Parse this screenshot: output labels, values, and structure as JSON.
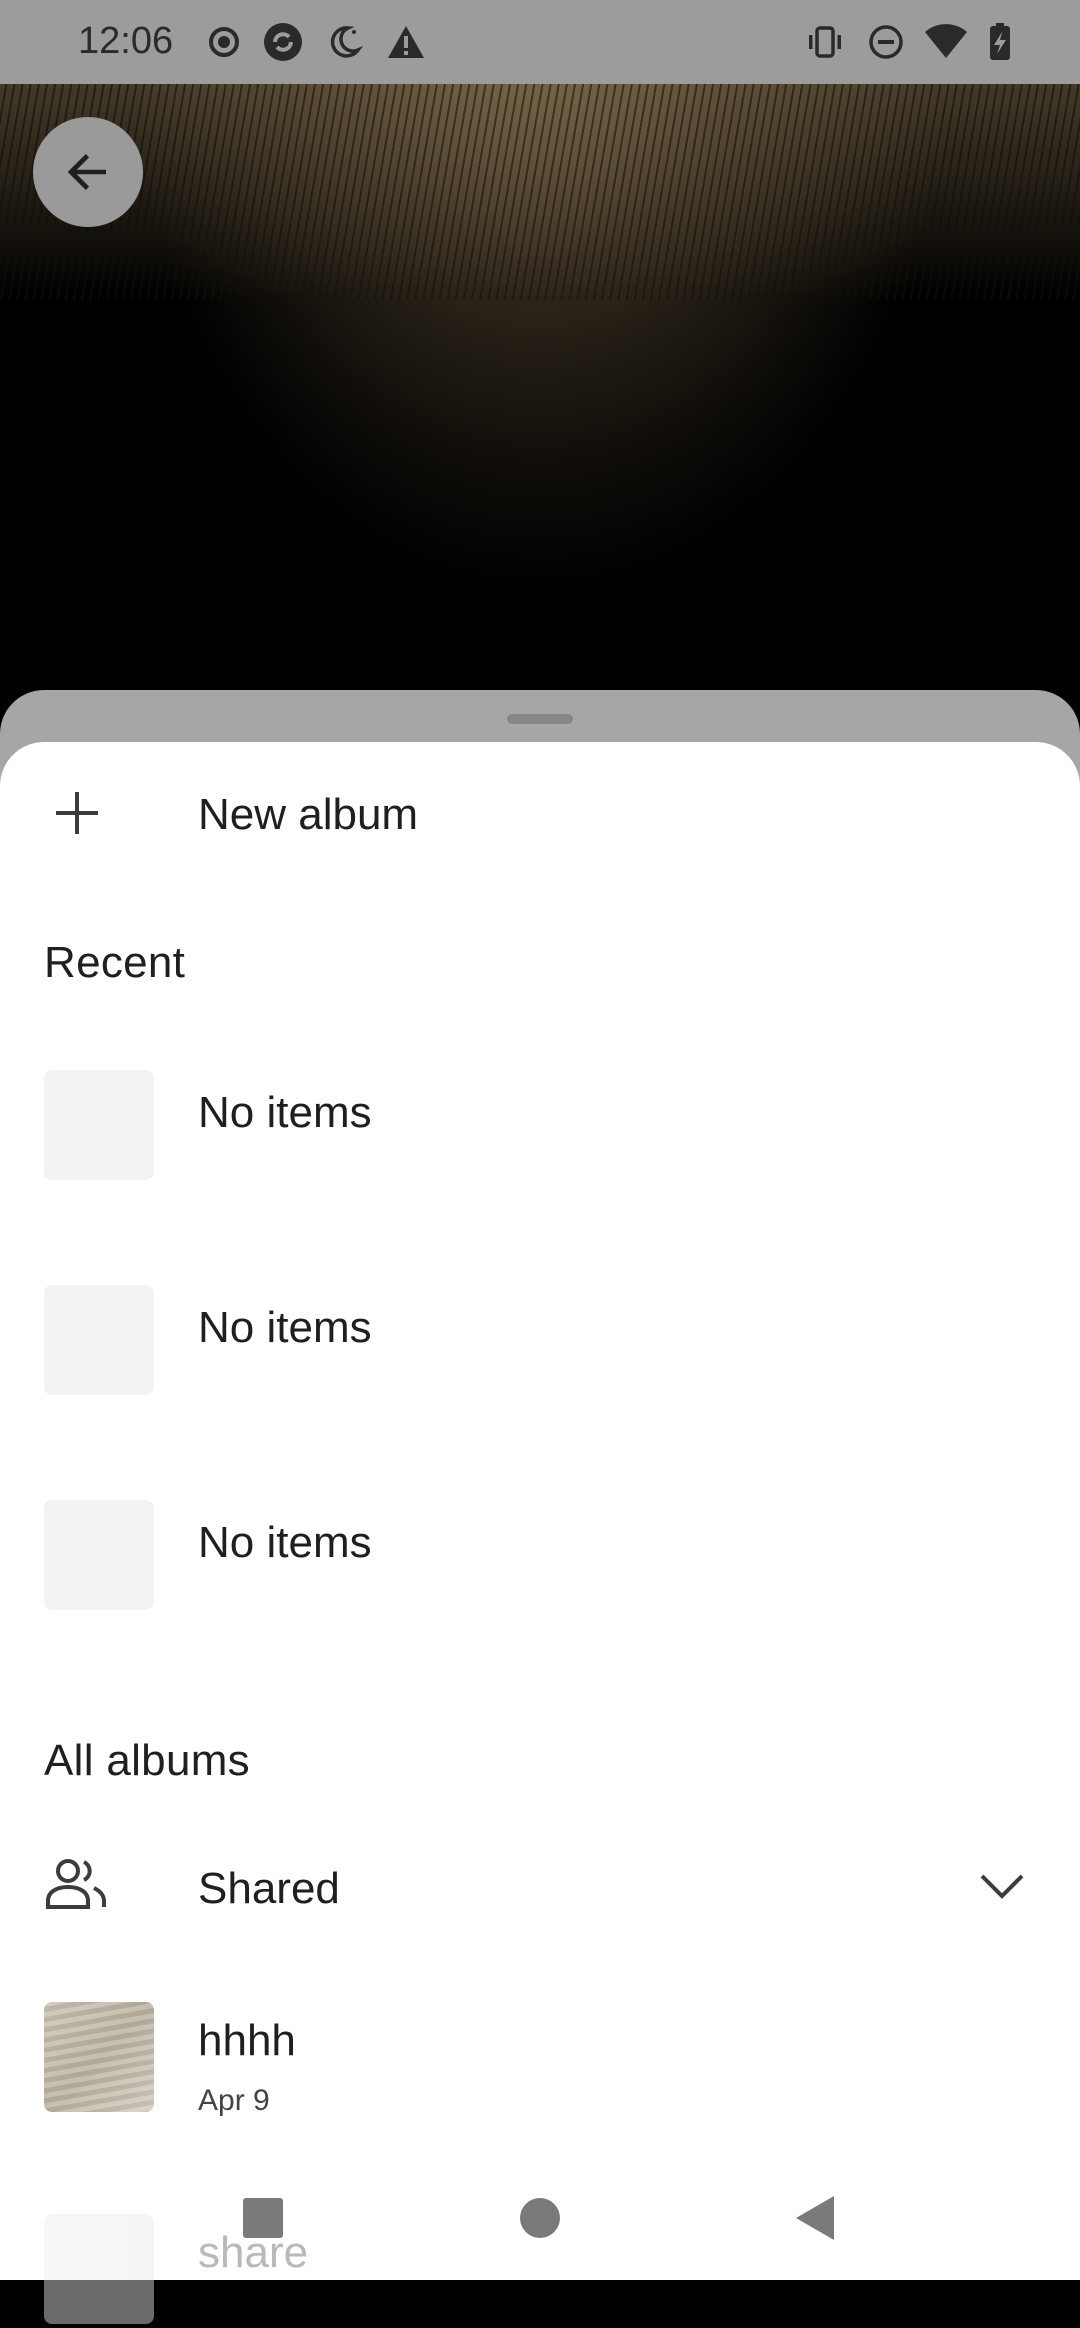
{
  "status_bar": {
    "time": "12:06",
    "left_icons": [
      "record-icon",
      "sync-icon",
      "do-not-disturb-moon-icon",
      "warning-icon"
    ],
    "right_icons": [
      "vibrate-icon",
      "dnd-minus-icon",
      "wifi-icon",
      "battery-charging-icon"
    ]
  },
  "sheet": {
    "new_album_label": "New album",
    "recent_title": "Recent",
    "recent_items": [
      {
        "label": "No items"
      },
      {
        "label": "No items"
      },
      {
        "label": "No items"
      }
    ],
    "all_albums_title": "All albums",
    "shared_label": "Shared",
    "albums": [
      {
        "title": "hhhh",
        "date": "Apr 9"
      },
      {
        "title": "share"
      }
    ]
  },
  "colors": {
    "sheet_bg": "#ffffff",
    "placeholder_thumb": "#f1f3f4",
    "status_bar_bg": "#9c9c9c"
  }
}
